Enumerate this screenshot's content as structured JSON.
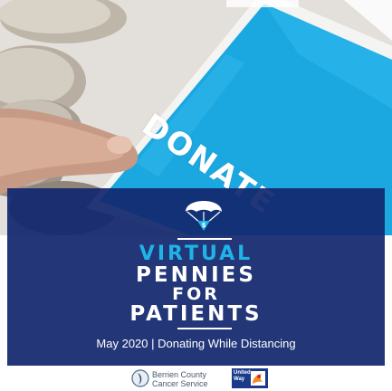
{
  "hero": {
    "phone_word": "DONATE"
  },
  "campaign": {
    "title_line1": "VIRTUAL",
    "title_line2": "PENNIES",
    "title_line3": "FOR",
    "title_line4": "PATIENTS",
    "tagline": "May 2020 | Donating While Distancing"
  },
  "colors": {
    "overlay_navy": "#12286e",
    "accent_cyan": "#1fb3e8",
    "phone_blue": "#1ba8e0",
    "text_white": "#ffffff"
  },
  "icons": {
    "parachute": "parachute-dollar-icon"
  },
  "footer": {
    "logo1_line1": "Berrien County",
    "logo1_line2": "Cancer Service",
    "logo2_text": "United Way"
  }
}
